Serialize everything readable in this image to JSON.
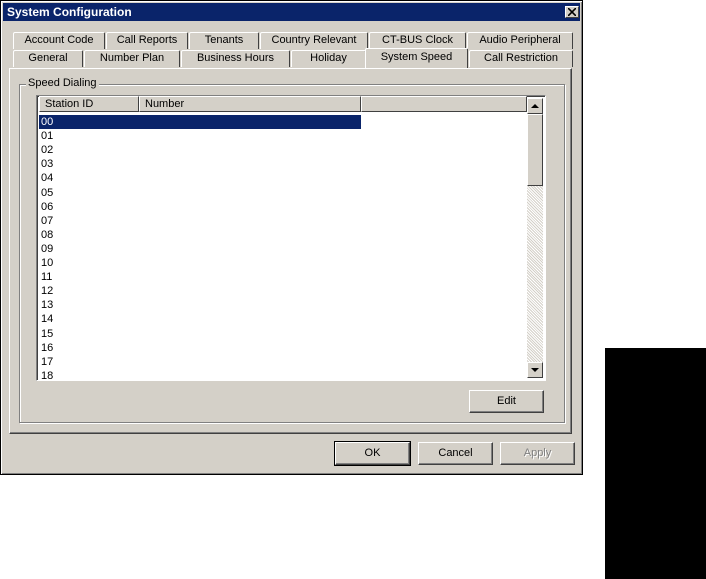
{
  "window": {
    "title": "System Configuration"
  },
  "tabs_back": [
    {
      "label": "Account Code"
    },
    {
      "label": "Call Reports"
    },
    {
      "label": "Tenants"
    },
    {
      "label": "Country Relevant"
    },
    {
      "label": "CT-BUS Clock"
    },
    {
      "label": "Audio Peripheral"
    }
  ],
  "tabs_front": [
    {
      "label": "General"
    },
    {
      "label": "Number Plan"
    },
    {
      "label": "Business Hours"
    },
    {
      "label": "Holiday"
    },
    {
      "label": "System Speed"
    },
    {
      "label": "Call Restriction"
    }
  ],
  "active_tab": "System Speed",
  "group": {
    "label": "Speed Dialing"
  },
  "list": {
    "columns": [
      "Station ID",
      "Number"
    ],
    "rows": [
      "00",
      "01",
      "02",
      "03",
      "04",
      "05",
      "06",
      "07",
      "08",
      "09",
      "10",
      "11",
      "12",
      "13",
      "14",
      "15",
      "16",
      "17",
      "18"
    ],
    "selected_index": 0
  },
  "buttons": {
    "edit": "Edit",
    "ok": "OK",
    "cancel": "Cancel",
    "apply": "Apply"
  },
  "colors": {
    "face": "#d4d0c8",
    "titlebar": "#0a246a",
    "selection": "#0a246a"
  }
}
